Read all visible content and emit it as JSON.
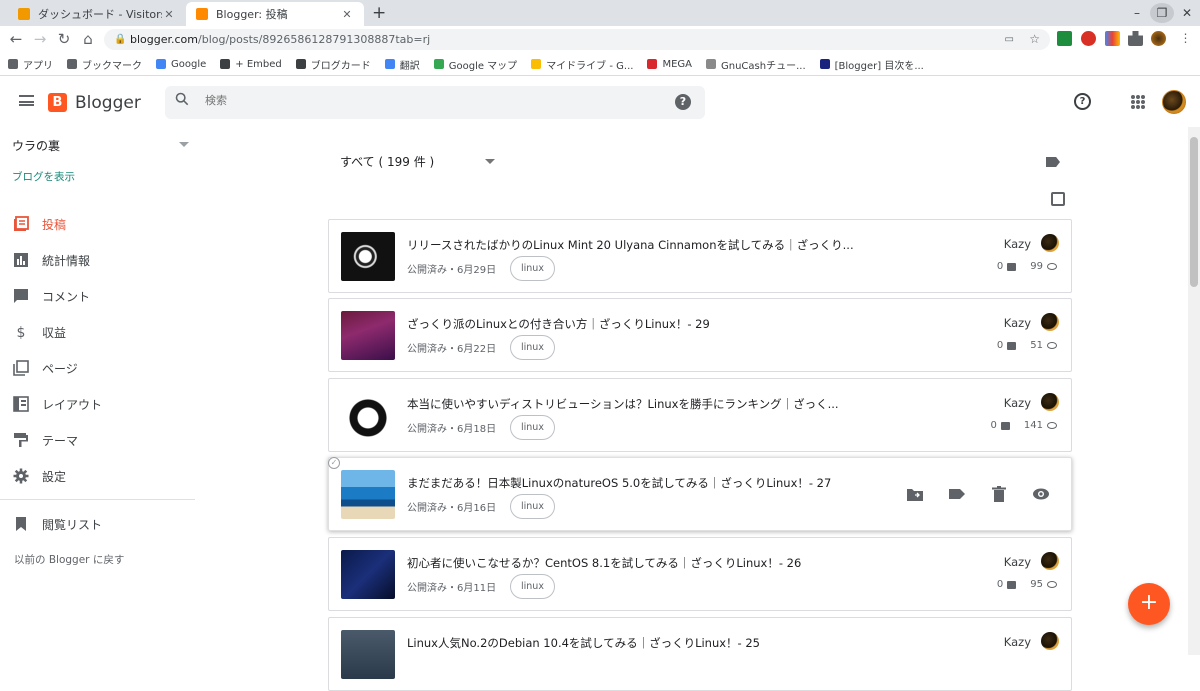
{
  "browser": {
    "tabs": [
      {
        "title": "ダッシュボード - Visitors - Vis",
        "favicon_color": "#f29900"
      },
      {
        "title": "Blogger: 投稿",
        "favicon_color": "#ff8a00"
      }
    ],
    "url_host": "blogger.com",
    "url_path": "/blog/posts/8926586128791308887tab=rj",
    "bookmarks": [
      {
        "label": "アプリ",
        "icon_color": "#5f6368"
      },
      {
        "label": "ブックマーク",
        "icon_color": "#5f6368"
      },
      {
        "label": "Google",
        "icon_color": "#4285f4"
      },
      {
        "label": "+ Embed",
        "icon_color": "#3c4043"
      },
      {
        "label": "ブログカード",
        "icon_color": "#3c4043"
      },
      {
        "label": "翻訳",
        "icon_color": "#4285f4"
      },
      {
        "label": "Google マップ",
        "icon_color": "#34a853"
      },
      {
        "label": "マイドライブ - G...",
        "icon_color": "#fbbc04"
      },
      {
        "label": "MEGA",
        "icon_color": "#d9272e"
      },
      {
        "label": "GnuCashチュー...",
        "icon_color": "#8a8a8a"
      },
      {
        "label": "[Blogger] 目次を...",
        "icon_color": "#1a237e"
      }
    ]
  },
  "header": {
    "app_name": "Blogger",
    "search_placeholder": "検索"
  },
  "sidebar": {
    "blog_name": "ウラの裏",
    "view_blog": "ブログを表示",
    "items": [
      {
        "label": "投稿",
        "icon": "posts-icon",
        "active": true
      },
      {
        "label": "統計情報",
        "icon": "stats-icon",
        "active": false
      },
      {
        "label": "コメント",
        "icon": "comment-icon",
        "active": false
      },
      {
        "label": "収益",
        "icon": "dollar-icon",
        "active": false
      },
      {
        "label": "ページ",
        "icon": "pages-icon",
        "active": false
      },
      {
        "label": "レイアウト",
        "icon": "layout-icon",
        "active": false
      },
      {
        "label": "テーマ",
        "icon": "theme-icon",
        "active": false
      },
      {
        "label": "設定",
        "icon": "gear-icon",
        "active": false
      },
      {
        "label": "閲覧リスト",
        "icon": "bookmark-icon",
        "active": false
      }
    ],
    "back_link": "以前の Blogger に戻す"
  },
  "main": {
    "filter_label": "すべて ( 199 件 )",
    "posts": [
      {
        "title": "リリースされたばかりのLinux Mint 20 Ulyana Cinnamonを試してみる｜ざっくり...",
        "status": "公開済み・6月29日",
        "label": "linux",
        "author": "Kazy",
        "comments": "0",
        "views": "99"
      },
      {
        "title": "ざっくり派のLinuxとの付き合い方｜ざっくりLinux！- 29",
        "status": "公開済み・6月22日",
        "label": "linux",
        "author": "Kazy",
        "comments": "0",
        "views": "51"
      },
      {
        "title": "本当に使いやすいディストリビューションは？Linuxを勝手にランキング｜ざっく...",
        "status": "公開済み・6月18日",
        "label": "linux",
        "author": "Kazy",
        "comments": "0",
        "views": "141"
      },
      {
        "title": "まだまだある！日本製LinuxのnatureOS 5.0を試してみる｜ざっくりLinux！- 27",
        "status": "公開済み・6月16日",
        "label": "linux",
        "author": "",
        "comments": "",
        "views": ""
      },
      {
        "title": "初心者に使いこなせるか？CentOS 8.1を試してみる｜ざっくりLinux！- 26",
        "status": "公開済み・6月11日",
        "label": "linux",
        "author": "Kazy",
        "comments": "0",
        "views": "95"
      },
      {
        "title": "Linux人気No.2のDebian 10.4を試してみる｜ざっくりLinux！- 25",
        "status": "",
        "label": "",
        "author": "Kazy",
        "comments": "",
        "views": ""
      }
    ]
  },
  "colors": {
    "accent": "#ff5722",
    "active_nav": "#e8553a",
    "link": "#1a8a7a"
  }
}
